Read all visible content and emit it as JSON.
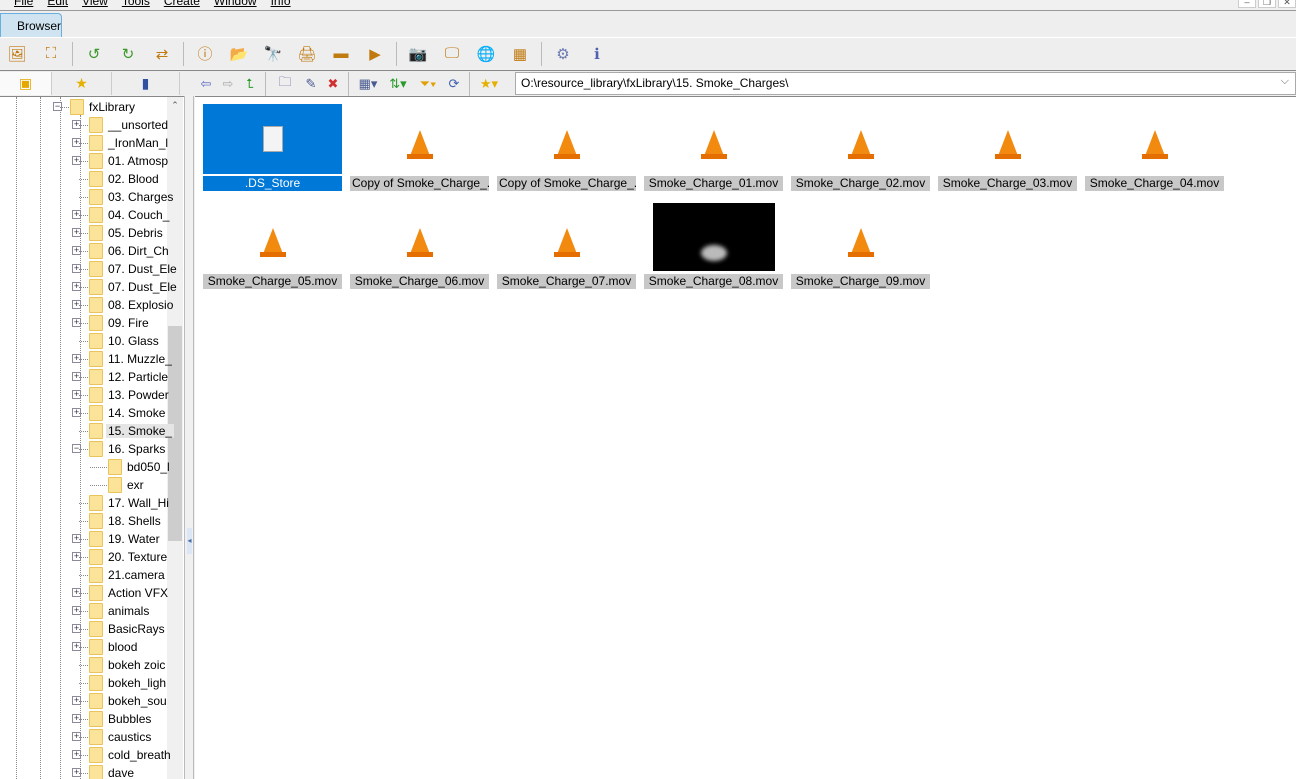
{
  "menu": [
    "File",
    "Edit",
    "View",
    "Tools",
    "Create",
    "Window",
    "Info"
  ],
  "tab": {
    "label": "Browser"
  },
  "toolbar_icons": [
    "view-image-icon",
    "fullscreen-icon",
    "rotate-left-icon",
    "rotate-right-icon",
    "convert-icon",
    "properties-icon",
    "open-with-icon",
    "find-icon",
    "print-icon",
    "scan-icon",
    "slideshow-icon",
    "screenshot-icon",
    "wallpaper-icon",
    "web-icon",
    "contact-sheet-icon",
    "settings-icon",
    "info-icon"
  ],
  "pane_tabs": [
    "folders-tab",
    "favorites-tab",
    "catalog-tab"
  ],
  "nav_icons": [
    "back-icon",
    "forward-icon",
    "up-icon",
    "new-folder-icon",
    "rename-icon",
    "delete-icon",
    "view-mode-icon",
    "sort-icon",
    "filter-icon",
    "refresh-icon",
    "favorites-icon"
  ],
  "path": "O:\\resource_library\\fxLibrary\\15. Smoke_Charges\\",
  "tree": {
    "root": "fxLibrary",
    "items": [
      {
        "label": "__unsorted",
        "exp": true
      },
      {
        "label": "_IronMan_l",
        "exp": true
      },
      {
        "label": "01. Atmosp",
        "exp": true
      },
      {
        "label": "02. Blood",
        "exp": false
      },
      {
        "label": "03. Charges",
        "exp": false
      },
      {
        "label": "04. Couch_",
        "exp": true
      },
      {
        "label": "05. Debris",
        "exp": true
      },
      {
        "label": "06. Dirt_Ch",
        "exp": true
      },
      {
        "label": "07. Dust_Ele",
        "exp": true
      },
      {
        "label": "07. Dust_Ele",
        "exp": true
      },
      {
        "label": "08. Explosio",
        "exp": true
      },
      {
        "label": "09. Fire",
        "exp": true
      },
      {
        "label": "10. Glass",
        "exp": false
      },
      {
        "label": "11. Muzzle_",
        "exp": true
      },
      {
        "label": "12. Particle",
        "exp": true
      },
      {
        "label": "13. Powder",
        "exp": true
      },
      {
        "label": "14. Smoke",
        "exp": true
      },
      {
        "label": "15. Smoke_",
        "exp": false,
        "selected": true
      },
      {
        "label": "16. Sparks",
        "exp": true,
        "open": true
      },
      {
        "label": "bd050_l",
        "child": true
      },
      {
        "label": "exr",
        "child": true
      },
      {
        "label": "17. Wall_Hi",
        "exp": false
      },
      {
        "label": "18. Shells",
        "exp": false
      },
      {
        "label": "19. Water",
        "exp": true
      },
      {
        "label": "20. Texture",
        "exp": true
      },
      {
        "label": "21.camera",
        "exp": false
      },
      {
        "label": "Action VFX",
        "exp": true
      },
      {
        "label": "animals",
        "exp": true
      },
      {
        "label": "BasicRays",
        "exp": true
      },
      {
        "label": "blood",
        "exp": true
      },
      {
        "label": "bokeh zoic",
        "exp": false
      },
      {
        "label": "bokeh_ligh",
        "exp": false
      },
      {
        "label": "bokeh_sou",
        "exp": true
      },
      {
        "label": "Bubbles",
        "exp": true
      },
      {
        "label": "caustics",
        "exp": true
      },
      {
        "label": "cold_breath",
        "exp": true
      },
      {
        "label": "dave",
        "exp": true
      }
    ]
  },
  "files": [
    {
      "name": ".DS_Store",
      "type": "doc",
      "selected": true
    },
    {
      "name": "Copy of Smoke_Charge_...",
      "type": "vlc"
    },
    {
      "name": "Copy of Smoke_Charge_...",
      "type": "vlc"
    },
    {
      "name": "Smoke_Charge_01.mov",
      "type": "vlc"
    },
    {
      "name": "Smoke_Charge_02.mov",
      "type": "vlc"
    },
    {
      "name": "Smoke_Charge_03.mov",
      "type": "vlc"
    },
    {
      "name": "Smoke_Charge_04.mov",
      "type": "vlc"
    },
    {
      "name": "Smoke_Charge_05.mov",
      "type": "vlc"
    },
    {
      "name": "Smoke_Charge_06.mov",
      "type": "vlc"
    },
    {
      "name": "Smoke_Charge_07.mov",
      "type": "vlc"
    },
    {
      "name": "Smoke_Charge_08.mov",
      "type": "video"
    },
    {
      "name": "Smoke_Charge_09.mov",
      "type": "vlc"
    }
  ]
}
